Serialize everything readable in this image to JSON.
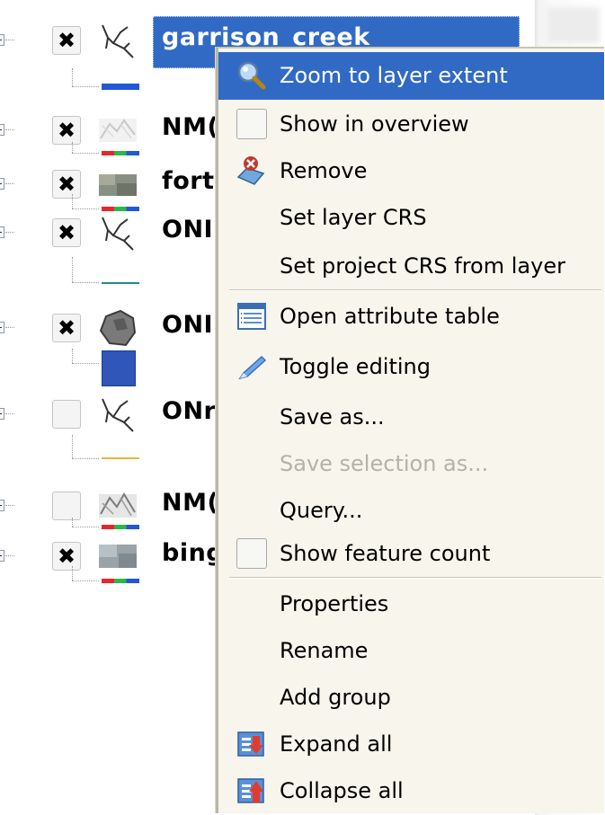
{
  "layer_tree": {
    "layers": [
      {
        "name": "garrison_creek",
        "checked": true,
        "selected": true,
        "checkmark": "✖",
        "icon": "line-layer-icon",
        "legend": "line-blue"
      },
      {
        "name": "NM(",
        "checked": true,
        "checkmark": "✖",
        "icon": "raster-thumbnail-icon",
        "legend": "rgb-bar"
      },
      {
        "name": "forty",
        "checked": true,
        "checkmark": "✖",
        "icon": "raster-thumbnail-icon",
        "legend": "rgb-bar"
      },
      {
        "name": "ONI",
        "checked": true,
        "checkmark": "✖",
        "icon": "line-layer-icon",
        "legend": "line-teal"
      },
      {
        "name": "ONI",
        "checked": true,
        "checkmark": "✖",
        "icon": "polygon-layer-icon",
        "legend": "polygon-blue"
      },
      {
        "name": "ONr",
        "checked": false,
        "checkmark": "",
        "icon": "line-layer-icon",
        "legend": "line-yellow"
      },
      {
        "name": "NM(",
        "checked": false,
        "checkmark": "",
        "icon": "raster-thumbnail-icon",
        "legend": "rgb-bar"
      },
      {
        "name": "bing",
        "checked": true,
        "checkmark": "✖",
        "icon": "raster-thumbnail-icon",
        "legend": "rgb-bar"
      }
    ]
  },
  "context_menu": {
    "items": [
      {
        "label": "Zoom to layer extent",
        "icon": "magnifier-icon",
        "highlighted": true
      },
      {
        "label": "Show in overview",
        "icon": "checkbox-icon"
      },
      {
        "label": "Remove",
        "icon": "remove-layer-icon"
      },
      {
        "label": "Set layer CRS",
        "icon": ""
      },
      {
        "label": "Set project CRS from layer",
        "icon": ""
      },
      {
        "label": "Open attribute table",
        "icon": "table-icon"
      },
      {
        "label": "Toggle editing",
        "icon": "pencil-icon"
      },
      {
        "label": "Save as...",
        "icon": ""
      },
      {
        "label": "Save selection as...",
        "icon": "",
        "disabled": true
      },
      {
        "label": "Query...",
        "icon": ""
      },
      {
        "label": "Show feature count",
        "icon": "checkbox-icon"
      },
      {
        "label": "Properties",
        "icon": ""
      },
      {
        "label": "Rename",
        "icon": ""
      },
      {
        "label": "Add group",
        "icon": ""
      },
      {
        "label": "Expand all",
        "icon": "expand-all-icon"
      },
      {
        "label": "Collapse all",
        "icon": "collapse-all-icon"
      }
    ]
  },
  "colors": {
    "highlight": "#316ac5",
    "menu_background": "#f7f5ec",
    "legend_red": "#e8262c",
    "legend_green": "#2bb84a",
    "legend_blue": "#2356d8"
  }
}
